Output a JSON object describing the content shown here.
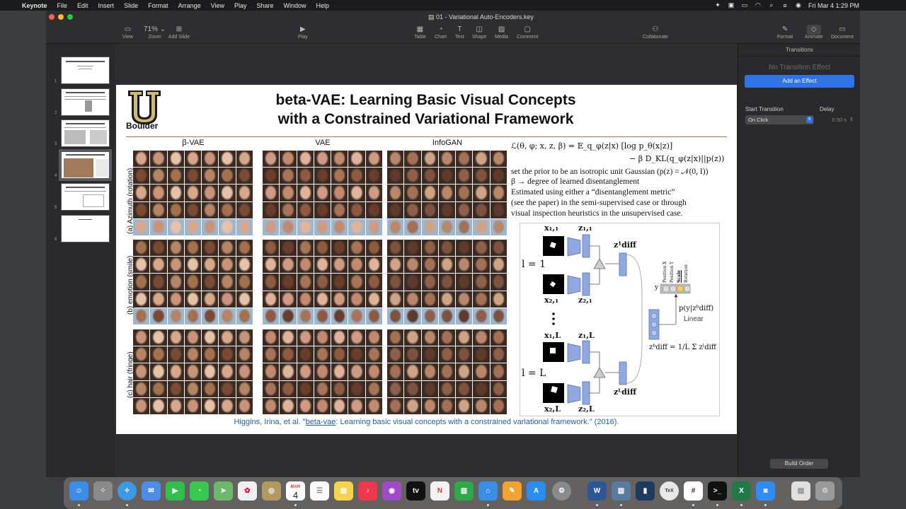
{
  "menubar": {
    "app_name": "Keynote",
    "items": [
      "File",
      "Edit",
      "Insert",
      "Slide",
      "Format",
      "Arrange",
      "View",
      "Play",
      "Share",
      "Window",
      "Help"
    ],
    "datetime": "Fri Mar 4  1:29 PM"
  },
  "window": {
    "doc_title": "01 - Variational Auto-Encoders.key",
    "toolbar": {
      "view": "View",
      "zoom_value": "71%",
      "zoom": "Zoom",
      "add_slide": "Add Slide",
      "play": "Play",
      "table": "Table",
      "chart": "Chart",
      "text": "Text",
      "shape": "Shape",
      "media": "Media",
      "comment": "Comment",
      "collaborate": "Collaborate",
      "format": "Format",
      "animate": "Animate",
      "document": "Document"
    }
  },
  "navigator": {
    "slide_numbers": [
      "1",
      "2",
      "3",
      "4",
      "5",
      "6"
    ],
    "selected": "4"
  },
  "slide": {
    "logo_text": "Boulder",
    "title": "beta-VAE: Learning Basic Visual Concepts\nwith a Constrained Variational Framework",
    "columns": [
      "β-VAE",
      "VAE",
      "InfoGAN"
    ],
    "rows": [
      "(a) Azimuth (rotation)",
      "(b) emotion (smile)",
      "(c) hair (fringe)"
    ],
    "equation_line1": "ℒ(θ, φ; x, z, β) = 𝔼_q_φ(z|x) [log p_θ(x|z)]",
    "equation_line2": "− β D_KL(q_φ(z|x)||p(z))",
    "text_lines": [
      "set the prior to be an isotropic unit Gaussian (p(z) = 𝒩(0, I))",
      "β → degree of learned disentanglement",
      "Estimated using either a “disentanglement metric”",
      "(see the paper) in the semi-supervised case or through",
      "visual inspection heuristics in the unsupervised case."
    ],
    "diagram": {
      "x11": "x₁,₁",
      "z11": "z₁,₁",
      "x21": "x₂,₁",
      "z21": "z₂,₁",
      "x1L": "x₁,L",
      "z1L": "z₁,L",
      "x2L": "x₂,L",
      "z2L": "z₂,L",
      "l1": "l = 1",
      "lL": "l = L",
      "zdiff1": "z¹diff",
      "zdiffL": "zᴸdiff",
      "factors": [
        "Position X",
        "Position Y",
        "Scale",
        "Rotation"
      ],
      "y": "y",
      "prob": "p(y|zᵇdiff)",
      "linear": "Linear",
      "sum_eq": "zᵇdiff = 1/L Σ zˡdiff"
    },
    "citation_prefix": "Higgins, Irina, et al. \"",
    "citation_link": "beta-vae",
    "citation_suffix": ": Learning basic visual concepts with a constrained variational framework.\" (2016)."
  },
  "inspector": {
    "title": "Transitions",
    "no_effect": "No Transition Effect",
    "add_effect": "Add an Effect",
    "start_transition_label": "Start Transition",
    "start_transition_value": "On Click",
    "delay_label": "Delay",
    "delay_value": "0.50 s",
    "build_order": "Build Order"
  },
  "dock": {
    "calendar_month": "MAR",
    "calendar_day": "4"
  },
  "colors": {
    "accent": "#2e74e8",
    "citation": "#2660a4",
    "rule": "#b07a50",
    "diagram_blue": "#8fa8e0"
  }
}
